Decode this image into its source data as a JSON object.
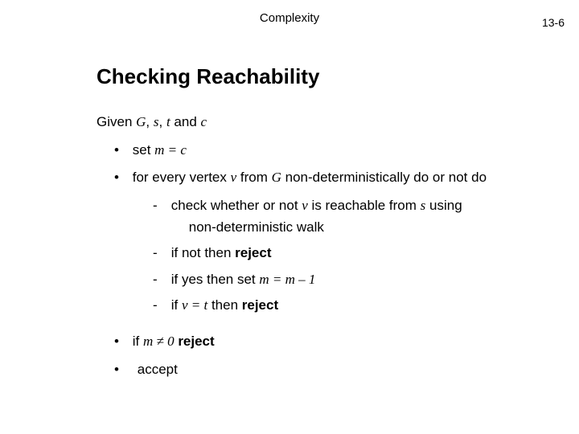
{
  "header": {
    "title": "Complexity",
    "page": "13-6"
  },
  "slide_title": "Checking Reachability",
  "given": {
    "prefix": "Given  ",
    "G": "G",
    "sep1": ",  ",
    "s": "s",
    "sep2": ",  ",
    "t": "t",
    "and": "  and  ",
    "c": "c"
  },
  "b1": {
    "dot": "•",
    "set": "set  ",
    "eq": "m = c"
  },
  "b2": {
    "dot": "•",
    "pre": "for every vertex  ",
    "v": "v",
    "mid": "  from  ",
    "G": "G",
    "post": "  non-deterministically do or not do"
  },
  "d1": {
    "dash": "-",
    "t1": "check whether or not  ",
    "v": "v",
    "t2": "  is reachable from  ",
    "s": "s",
    "t3": "  using",
    "t4": "non-deterministic walk"
  },
  "d2": {
    "dash": "-",
    "t": "if not then  ",
    "rj": "reject"
  },
  "d3": {
    "dash": "-",
    "t": "if  yes  then set  ",
    "eq": "m = m – 1"
  },
  "d4": {
    "dash": "-",
    "t1": "if  ",
    "eq": "v = t",
    "t2": "  then  ",
    "rj": "reject"
  },
  "b3": {
    "dot": "•",
    "t1": "if  ",
    "eq": "m ≠ 0",
    "sp": "   ",
    "rj": "reject"
  },
  "b4": {
    "dot": "•",
    "t": "accept"
  }
}
